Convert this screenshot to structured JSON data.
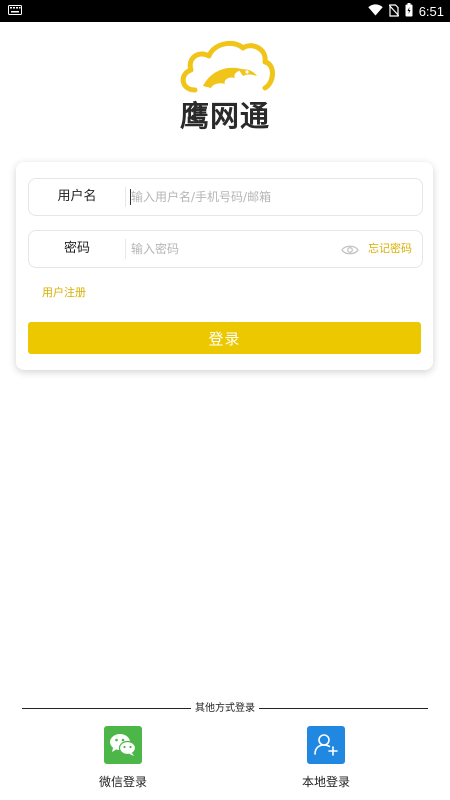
{
  "status_bar": {
    "time": "6:51",
    "icons": [
      "keyboard-icon",
      "wifi-icon",
      "no-sim-icon",
      "battery-icon"
    ]
  },
  "logo": {
    "text": "鹰网通",
    "icon": "cloud-eagle-logo",
    "color": "#f0c419"
  },
  "form": {
    "username": {
      "label": "用户名",
      "placeholder": "输入用户名/手机号码/邮箱",
      "value": ""
    },
    "password": {
      "label": "密码",
      "placeholder": "输入密码",
      "value": ""
    },
    "forgot_password": "忘记密码",
    "register": "用户注册",
    "login_button": "登录"
  },
  "other_login": {
    "title": "其他方式登录",
    "options": [
      {
        "label": "微信登录",
        "icon": "wechat-icon",
        "color": "#4cb748"
      },
      {
        "label": "本地登录",
        "icon": "add-user-icon",
        "color": "#2088e0"
      }
    ]
  },
  "colors": {
    "accent": "#ebc800",
    "link": "#d8b000"
  }
}
